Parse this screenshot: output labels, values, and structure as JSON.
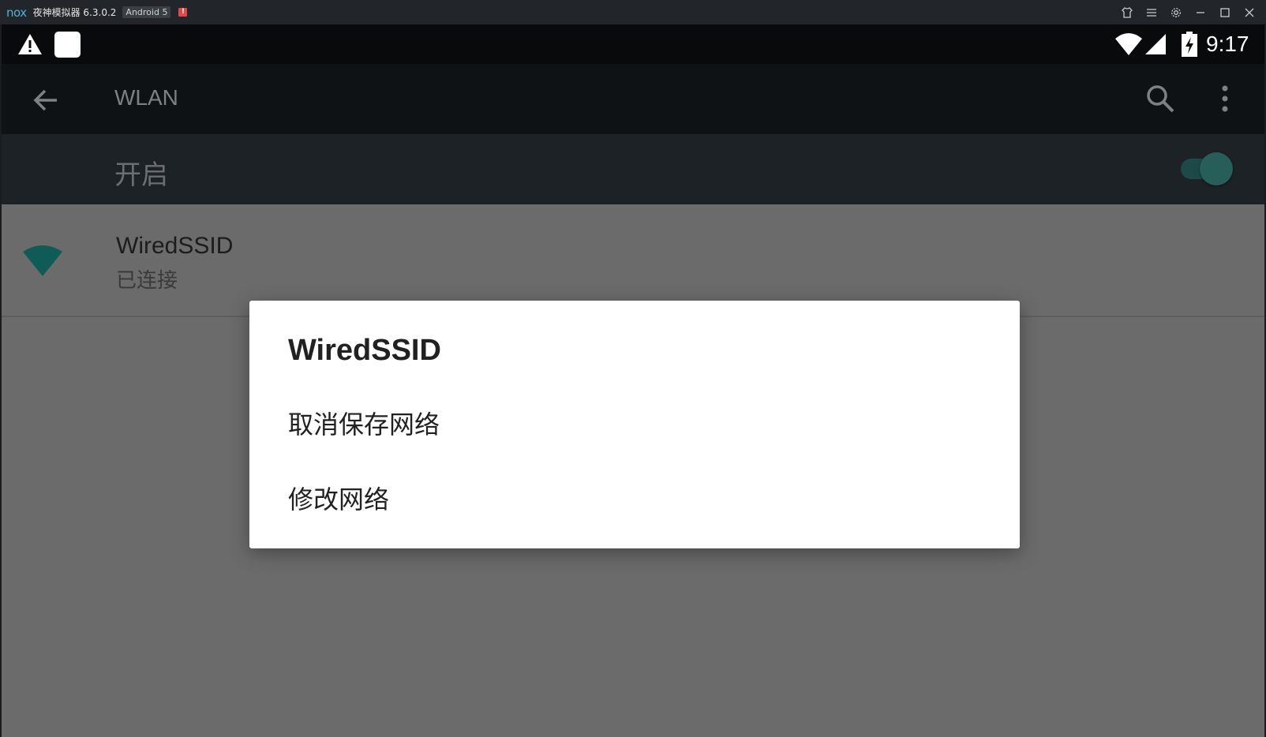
{
  "window": {
    "logo_text": "nox",
    "app_title": "夜神模拟器 6.3.0.2",
    "android_badge": "Android 5",
    "alert_mark": "!",
    "controls": [
      "shirt-icon",
      "menu-icon",
      "gear-icon",
      "minimize-icon",
      "maximize-icon",
      "close-icon"
    ]
  },
  "statusbar": {
    "time": "9:17",
    "icons": [
      "warning-icon",
      "notification-square-icon",
      "wifi-icon",
      "signal-icon",
      "battery-charging-icon"
    ]
  },
  "appbar": {
    "title": "WLAN",
    "icons": [
      "back-arrow-icon",
      "search-icon",
      "more-vert-icon"
    ]
  },
  "wlan_switch": {
    "label": "开启",
    "state": "on"
  },
  "network": {
    "ssid": "WiredSSID",
    "status": "已连接"
  },
  "dialog": {
    "title": "WiredSSID",
    "options": [
      "取消保存网络",
      "修改网络"
    ]
  },
  "colors": {
    "accent": "#0e5c55",
    "scrim_gray": "#6b6b6b",
    "dialog_bg": "#ffffff",
    "titlebar_bg": "#22262a"
  }
}
